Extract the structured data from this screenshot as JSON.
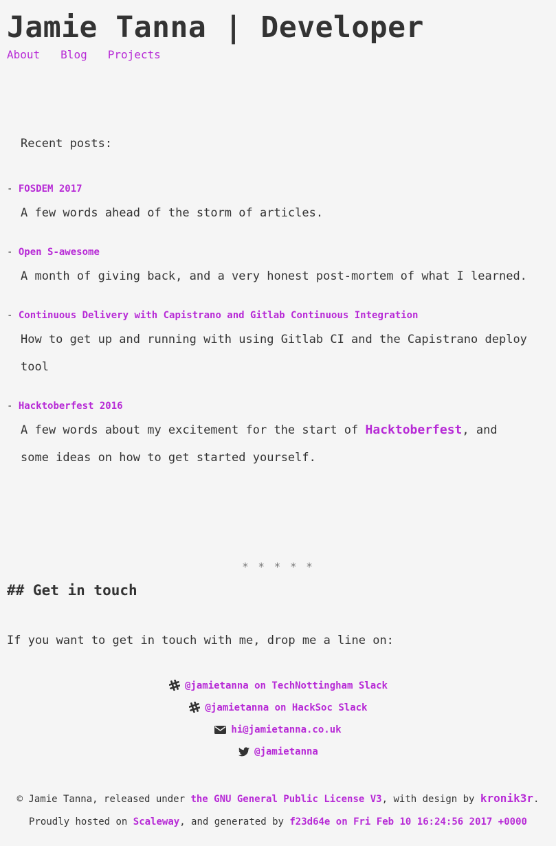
{
  "header": {
    "title": "Jamie Tanna | Developer",
    "nav": [
      {
        "label": "About"
      },
      {
        "label": "Blog"
      },
      {
        "label": "Projects"
      }
    ]
  },
  "recent": {
    "label": "Recent posts:",
    "dash": "-",
    "posts": [
      {
        "title": "FOSDEM 2017",
        "desc": "A few words ahead of the storm of articles."
      },
      {
        "title": "Open S-awesome",
        "desc": "A month of giving back, and a very honest post-mortem of what I learned."
      },
      {
        "title": "Continuous Delivery with Capistrano and Gitlab Continuous Integration",
        "desc": "How to get up and running with using Gitlab CI and the Capistrano deploy tool"
      },
      {
        "title": "Hacktoberfest 2016",
        "desc_before": "A few words about my excitement for the start of ",
        "desc_link": "Hacktoberfest",
        "desc_after": ", and some ideas on how to get started yourself."
      }
    ]
  },
  "divider": "* * * * *",
  "contact": {
    "heading": "## Get in touch",
    "intro": "If you want to get in touch with me, drop me a line on:",
    "items": [
      {
        "icon": "slack-icon",
        "label": "@jamietanna on TechNottingham Slack"
      },
      {
        "icon": "slack-icon",
        "label": "@jamietanna on HackSoc Slack"
      },
      {
        "icon": "envelope-icon",
        "label": "hi@jamietanna.co.uk"
      },
      {
        "icon": "twitter-icon",
        "label": "@jamietanna"
      }
    ]
  },
  "footer": {
    "line1_prefix": "© Jamie Tanna, released under ",
    "license_link": "the GNU General Public License V3",
    "line1_mid": ", with design by ",
    "design_link": "kronik3r",
    "line1_suffix": ".",
    "line2_prefix": "Proudly hosted on ",
    "host_link": "Scaleway",
    "line2_mid": ", and generated by ",
    "commit_link": "f23d64e on Fri Feb 10 16:24:56 2017 +0000"
  },
  "colors": {
    "link": "#b72ad6",
    "text": "#333333",
    "background": "#f5f5f5"
  }
}
